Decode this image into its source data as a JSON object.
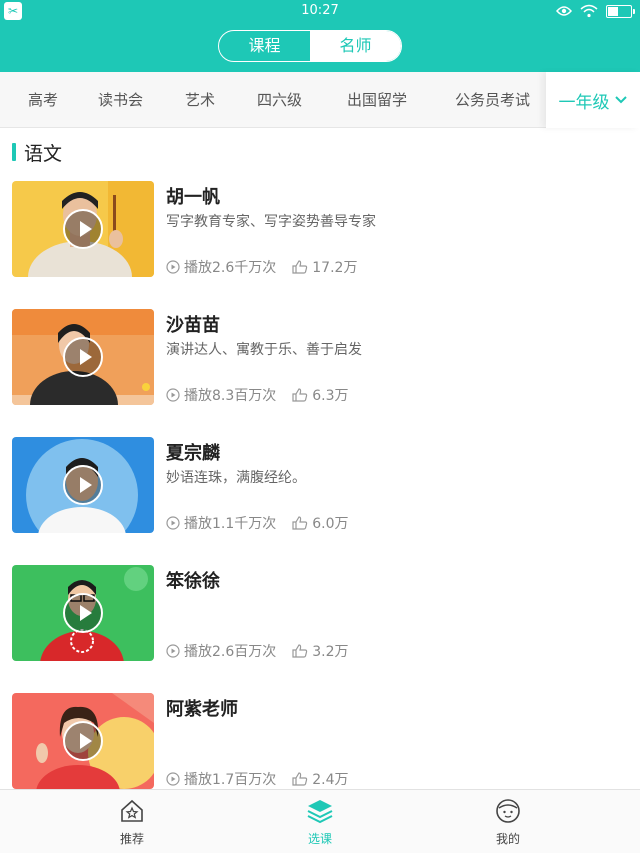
{
  "status_bar": {
    "time": "10:27"
  },
  "header": {
    "segments": [
      {
        "label": "课程",
        "active": false
      },
      {
        "label": "名师",
        "active": true
      }
    ]
  },
  "categories": [
    "高考",
    "读书会",
    "艺术",
    "四六级",
    "出国留学",
    "公务员考试"
  ],
  "grade_selector": {
    "label": "一年级"
  },
  "section": {
    "title": "语文"
  },
  "teachers": [
    {
      "name": "胡一帆",
      "desc": "写字教育专家、写字姿势善导专家",
      "plays": "播放2.6千万次",
      "likes": "17.2万"
    },
    {
      "name": "沙苗苗",
      "desc": "演讲达人、寓教于乐、善于启发",
      "plays": "播放8.3百万次",
      "likes": "6.3万"
    },
    {
      "name": "夏宗麟",
      "desc": "妙语连珠，满腹经纶。",
      "plays": "播放1.1千万次",
      "likes": "6.0万"
    },
    {
      "name": "笨徐徐",
      "desc": "",
      "plays": "播放2.6百万次",
      "likes": "3.2万"
    },
    {
      "name": "阿紫老师",
      "desc": "",
      "plays": "播放1.7百万次",
      "likes": "2.4万"
    }
  ],
  "tabbar": [
    {
      "label": "推荐",
      "active": false
    },
    {
      "label": "选课",
      "active": true
    },
    {
      "label": "我的",
      "active": false
    }
  ],
  "colors": {
    "accent": "#1ec8b6"
  }
}
